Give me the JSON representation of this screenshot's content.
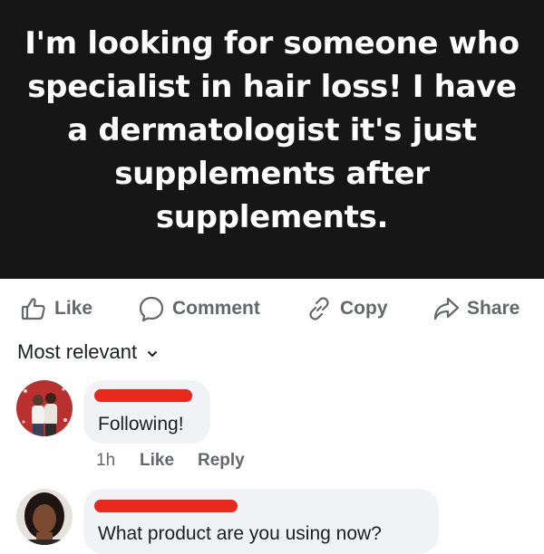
{
  "post": {
    "text": "I'm looking for someone who specialist in hair loss! I have a dermatologist it's just supplements after supplements."
  },
  "actions": {
    "like": "Like",
    "comment": "Comment",
    "copy": "Copy",
    "share": "Share"
  },
  "sort": {
    "label": "Most relevant"
  },
  "comments": [
    {
      "author_redacted": true,
      "text": "Following!",
      "time": "1h",
      "like": "Like",
      "reply": "Reply"
    },
    {
      "author_redacted": true,
      "text": "What product are you using now?"
    }
  ],
  "colors": {
    "banner": "#161616",
    "redaction": "#e8291b",
    "bubble": "#f0f2f5",
    "muted": "#65676b"
  }
}
